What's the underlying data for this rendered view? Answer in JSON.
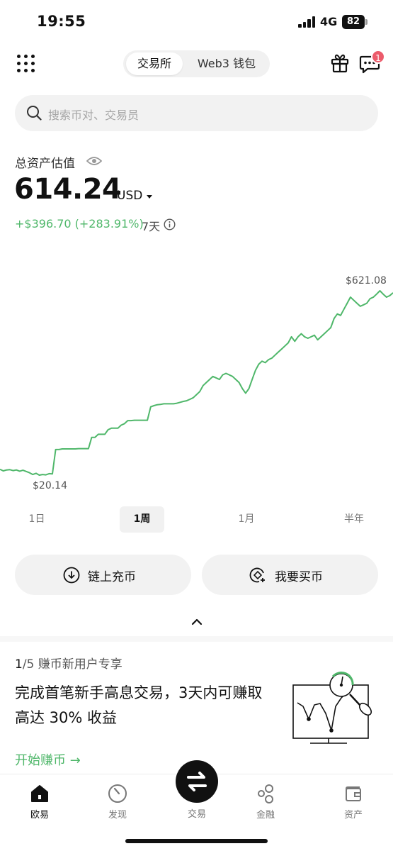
{
  "status_bar": {
    "time": "19:55",
    "network": "4G",
    "battery": "82"
  },
  "header": {
    "tabs": [
      {
        "label": "交易所",
        "active": true
      },
      {
        "label": "Web3 钱包",
        "active": false
      }
    ],
    "message_badge": "1"
  },
  "search": {
    "placeholder": "搜索币对、交易员"
  },
  "assets": {
    "label": "总资产估值",
    "value": "614.24",
    "currency": "USD",
    "pnl": "+$396.70 (+283.91%)",
    "period": "7天",
    "accent_color": "#4fb76a"
  },
  "chart_data": {
    "type": "line",
    "max_label": "$621.08",
    "min_label": "$20.14",
    "series": [
      {
        "values": [
          35,
          30,
          33,
          34,
          31,
          33,
          29,
          32,
          28,
          24,
          18,
          22,
          16,
          18,
          17,
          21,
          20,
          100,
          100,
          102,
          102,
          102,
          102,
          102,
          103,
          103,
          103,
          103,
          140,
          140,
          150,
          150,
          150,
          165,
          170,
          170,
          170,
          180,
          185,
          195,
          195,
          196,
          196,
          196,
          196,
          196,
          240,
          244,
          247,
          248,
          250,
          250,
          250,
          250,
          252,
          255,
          258,
          260,
          265,
          270,
          280,
          290,
          310,
          320,
          330,
          340,
          335,
          330,
          345,
          350,
          345,
          340,
          330,
          320,
          300,
          285,
          300,
          330,
          360,
          380,
          390,
          385,
          395,
          400,
          410,
          420,
          430,
          440,
          450,
          470,
          455,
          470,
          480,
          470,
          465,
          470,
          475,
          460,
          470,
          480,
          490,
          500,
          530,
          545,
          540,
          560,
          580,
          600,
          590,
          580,
          570,
          575,
          580,
          595,
          600,
          610,
          621,
          610,
          600,
          605,
          614.24
        ]
      }
    ],
    "range_tabs": [
      {
        "label": "1日",
        "active": false
      },
      {
        "label": "1周",
        "active": true
      },
      {
        "label": "1月",
        "active": false
      },
      {
        "label": "半年",
        "active": false
      }
    ]
  },
  "actions": {
    "deposit_label": "链上充币",
    "buy_label": "我要买币"
  },
  "promo": {
    "step_current": "1",
    "step_rest": "/5 赚币新用户专享",
    "title": "完成首笔新手高息交易，3天内可赚取高达 30% 收益",
    "cta": "开始赚币 →"
  },
  "bottom_nav": {
    "items": [
      {
        "label": "欧易",
        "active": true
      },
      {
        "label": "发现",
        "active": false
      },
      {
        "label": "交易",
        "active": false
      },
      {
        "label": "金融",
        "active": false
      },
      {
        "label": "资产",
        "active": false
      }
    ]
  }
}
